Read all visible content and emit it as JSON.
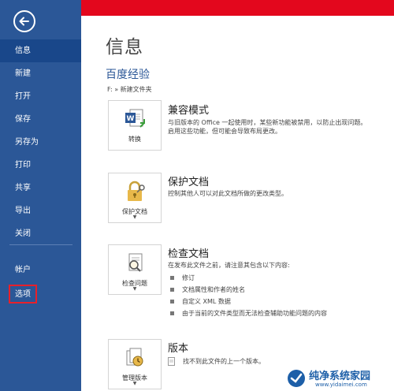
{
  "sidebar": {
    "items": [
      {
        "label": "信息"
      },
      {
        "label": "新建"
      },
      {
        "label": "打开"
      },
      {
        "label": "保存"
      },
      {
        "label": "另存为"
      },
      {
        "label": "打印"
      },
      {
        "label": "共享"
      },
      {
        "label": "导出"
      },
      {
        "label": "关闭"
      },
      {
        "label": "帐户"
      },
      {
        "label": "选项"
      }
    ],
    "active_index": 0
  },
  "main": {
    "title": "信息",
    "doc_name": "百度经验",
    "doc_path": "F: » 新建文件夹",
    "sections": {
      "compat": {
        "button_label": "转换",
        "title": "兼容模式",
        "desc_line1": "与旧版本的 Office 一起使用时，某些新功能被禁用，以防止出现问题。",
        "desc_line2": "启用这些功能，但可能会导致布局更改。"
      },
      "protect": {
        "button_label": "保护文档",
        "title": "保护文档",
        "desc": "控制其他人可以对此文档所做的更改类型。"
      },
      "inspect": {
        "button_label": "检查问题",
        "title": "检查文档",
        "desc": "在发布此文件之前，请注意其包含以下内容:",
        "bullets": [
          "修订",
          "文档属性和作者的姓名",
          "自定义 XML 数据",
          "由于当前的文件类型而无法检查辅助功能问题的内容"
        ]
      },
      "versions": {
        "button_label": "管理版本",
        "title": "版本",
        "desc": "找不到此文件的上一个版本。"
      }
    }
  },
  "watermark": {
    "name": "纯净系统家园",
    "url": "www.yidaimei.com"
  },
  "colors": {
    "sidebar": "#2b5797",
    "top_bar": "#e3071d",
    "accent": "#2b5797",
    "highlight_box": "#e8202a"
  }
}
